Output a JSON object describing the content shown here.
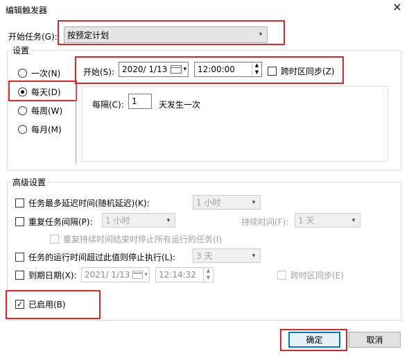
{
  "window": {
    "title": "编辑触发器",
    "close": "✕"
  },
  "start_task": {
    "label": "开始任务(G):",
    "value": "按预定计划"
  },
  "settings": {
    "legend": "设置",
    "radios": [
      {
        "label": "一次(N)",
        "selected": false
      },
      {
        "label": "每天(D)",
        "selected": true
      },
      {
        "label": "每周(W)",
        "selected": false
      },
      {
        "label": "每月(M)",
        "selected": false
      }
    ],
    "start_label": "开始(S):",
    "start_date": "2020/  1/13",
    "start_time": "12:00:00",
    "sync_tz_label": "跨时区同步(Z)",
    "every_label": "每隔(C):",
    "every_value": "1",
    "every_suffix": "天发生一次"
  },
  "advanced": {
    "legend": "高级设置",
    "max_delay": {
      "label": "任务最多延迟时间(随机延迟)(K):",
      "value": "1 小时"
    },
    "repeat": {
      "label": "重复任务间隔(P):",
      "value": "1 小时",
      "duration_label": "持续时间(F):",
      "duration_value": "1 天"
    },
    "stop_running": {
      "label": "重复持续时间结束时停止所有运行的任务(I)"
    },
    "stop_exceed": {
      "label": "任务的运行时间超过此值则停止执行(L):",
      "value": "3 天"
    },
    "expire": {
      "label": "到期日期(X):",
      "date": "2021/  1/13",
      "time": "12:14:32",
      "sync_label": "跨时区同步(E)"
    },
    "enabled": {
      "label": "已启用(B)",
      "checked": "☑"
    }
  },
  "buttons": {
    "ok": "确定",
    "cancel": "取消"
  },
  "icons": {
    "dropdown": "▾",
    "spin_up": "▲",
    "spin_down": "▼",
    "check": "✓"
  },
  "colors": {
    "highlight": "#e0252a",
    "default_button": "#0078d7"
  }
}
